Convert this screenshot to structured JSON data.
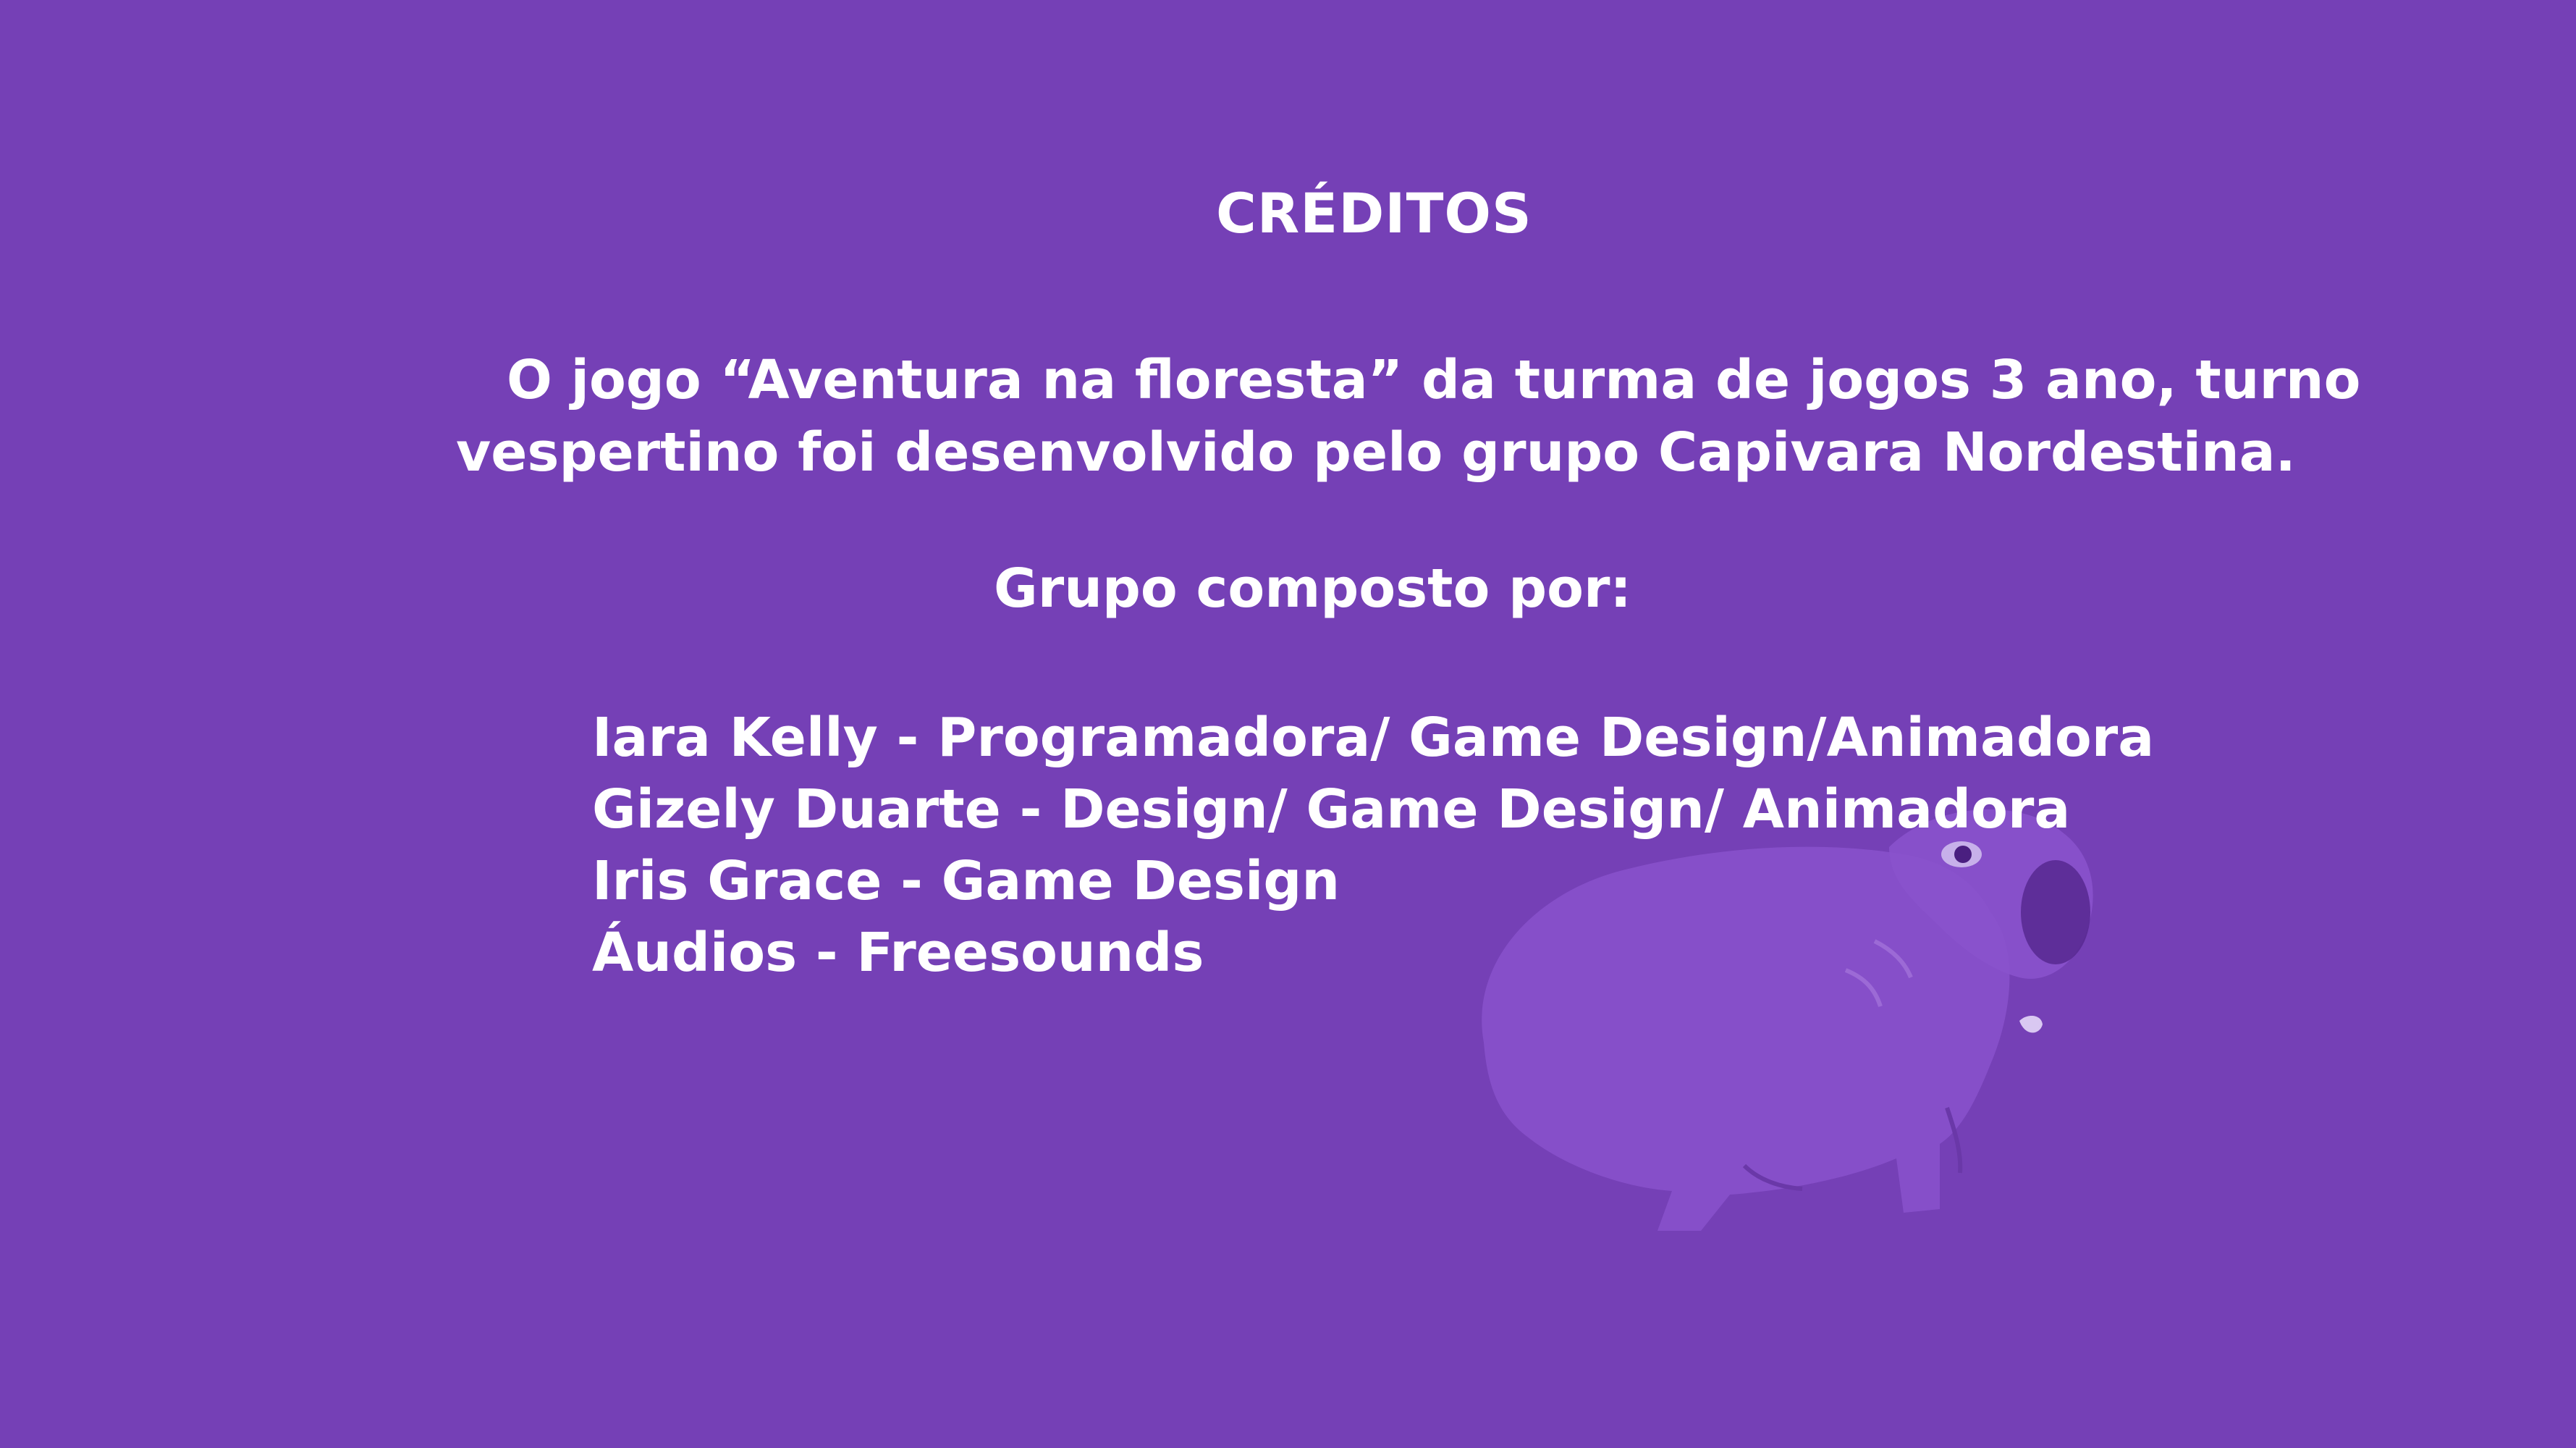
{
  "credits": {
    "title": "CRÉDITOS",
    "intro_line1": "O jogo “Aventura na floresta” da turma de jogos 3 ano, turno",
    "intro_line2": "vespertino foi desenvolvido  pelo grupo Capivara Nordestina.",
    "group_heading": "Grupo composto por:",
    "members": [
      "Iara Kelly - Programadora/ Game Design/Animadora",
      "Gizely Duarte - Design/ Game Design/ Animadora",
      "Iris Grace - Game Design",
      "Áudios - Freesounds"
    ]
  },
  "colors": {
    "background": "#7540b6",
    "text": "#ffffff",
    "mascot_body": "#8a52cc",
    "mascot_dark": "#5a2a94"
  },
  "mascot": {
    "icon": "capybara-icon"
  }
}
